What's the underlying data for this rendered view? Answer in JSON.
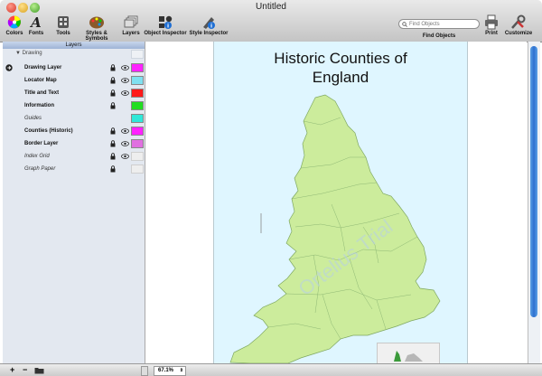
{
  "window": {
    "title": "Untitled"
  },
  "toolbar": {
    "colors": "Colors",
    "fonts": "Fonts",
    "tools": "Tools",
    "styles": "Styles & Symbols",
    "layers": "Layers",
    "object_inspector": "Object Inspector",
    "style_inspector": "Style Inspector",
    "find_placeholder": "Find Objects",
    "find_label": "Find Objects",
    "print": "Print",
    "customize": "Customize"
  },
  "sidebar": {
    "header": "Layers",
    "group": "Drawing",
    "layers": [
      {
        "name": "Drawing Layer",
        "bold": true,
        "visible": true,
        "swatch": "#ff22ff"
      },
      {
        "name": "Locator Map",
        "bold": true,
        "visible": true,
        "swatch": "#7fe0f0"
      },
      {
        "name": "Title and Text",
        "bold": true,
        "visible": true,
        "swatch": "#ff1a1a"
      },
      {
        "name": "Information",
        "bold": true,
        "visible": false,
        "swatch": "#22dd22"
      },
      {
        "name": "Guides",
        "bold": false,
        "visible": false,
        "swatch": "#30e8d8"
      },
      {
        "name": "Counties (Historic)",
        "bold": true,
        "visible": true,
        "swatch": "#ff22ff"
      },
      {
        "name": "Border Layer",
        "bold": true,
        "visible": true,
        "swatch": "#e070e0"
      },
      {
        "name": "Index Grid",
        "bold": false,
        "visible": true,
        "swatch": "#eeeeee"
      },
      {
        "name": "Graph Paper",
        "bold": false,
        "visible": false,
        "swatch": "#eeeeee"
      }
    ]
  },
  "bottom": {
    "add": "+",
    "remove": "−",
    "zoom": "67.1%"
  },
  "map": {
    "title_line1": "Historic Counties of",
    "title_line2": "England",
    "watermark": "Ortelius Trial"
  },
  "colors": {
    "page": "#dff6ff",
    "land": "#ccec9c",
    "selection": "#1f6fd4"
  }
}
